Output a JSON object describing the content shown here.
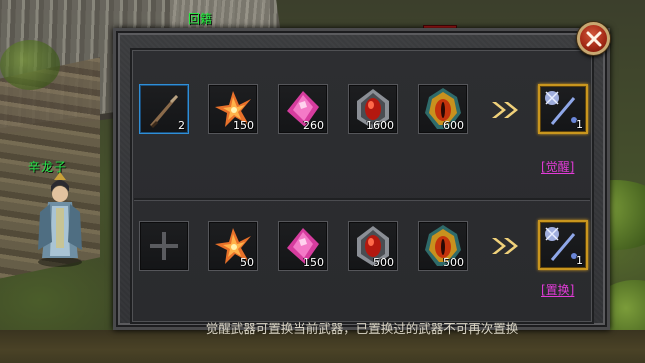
{
  "world": {
    "map_label": "回籍",
    "npc_name": "辛龙子"
  },
  "panel": {
    "close_icon": "close-x-icon",
    "notice": "觉醒武器可置换当前武器，已置换过的武器不可再次置换",
    "awaken_row": {
      "action_label": "[觉醒]",
      "slots": [
        {
          "item": "dagger-weapon-icon",
          "count": "2",
          "selected": true
        },
        {
          "item": "orange-crystal-icon",
          "count": "150"
        },
        {
          "item": "pink-gem-icon",
          "count": "260"
        },
        {
          "item": "red-jewel-silver-icon",
          "count": "1600"
        },
        {
          "item": "red-jewel-gold-icon",
          "count": "600"
        }
      ],
      "result": {
        "item": "crystal-staff-icon",
        "count": "1"
      }
    },
    "replace_row": {
      "action_label": "[置换]",
      "slots": [
        {
          "item": "empty-plus-icon",
          "count": ""
        },
        {
          "item": "orange-crystal-icon",
          "count": "50"
        },
        {
          "item": "pink-gem-icon",
          "count": "150"
        },
        {
          "item": "red-jewel-silver-icon",
          "count": "500"
        },
        {
          "item": "red-jewel-gold-icon",
          "count": "500"
        }
      ],
      "result": {
        "item": "crystal-staff-icon",
        "count": "1"
      }
    }
  },
  "colors": {
    "accent_gold": "#c9961e",
    "link_magenta": "#e23bd8",
    "name_green": "#24e84a"
  }
}
